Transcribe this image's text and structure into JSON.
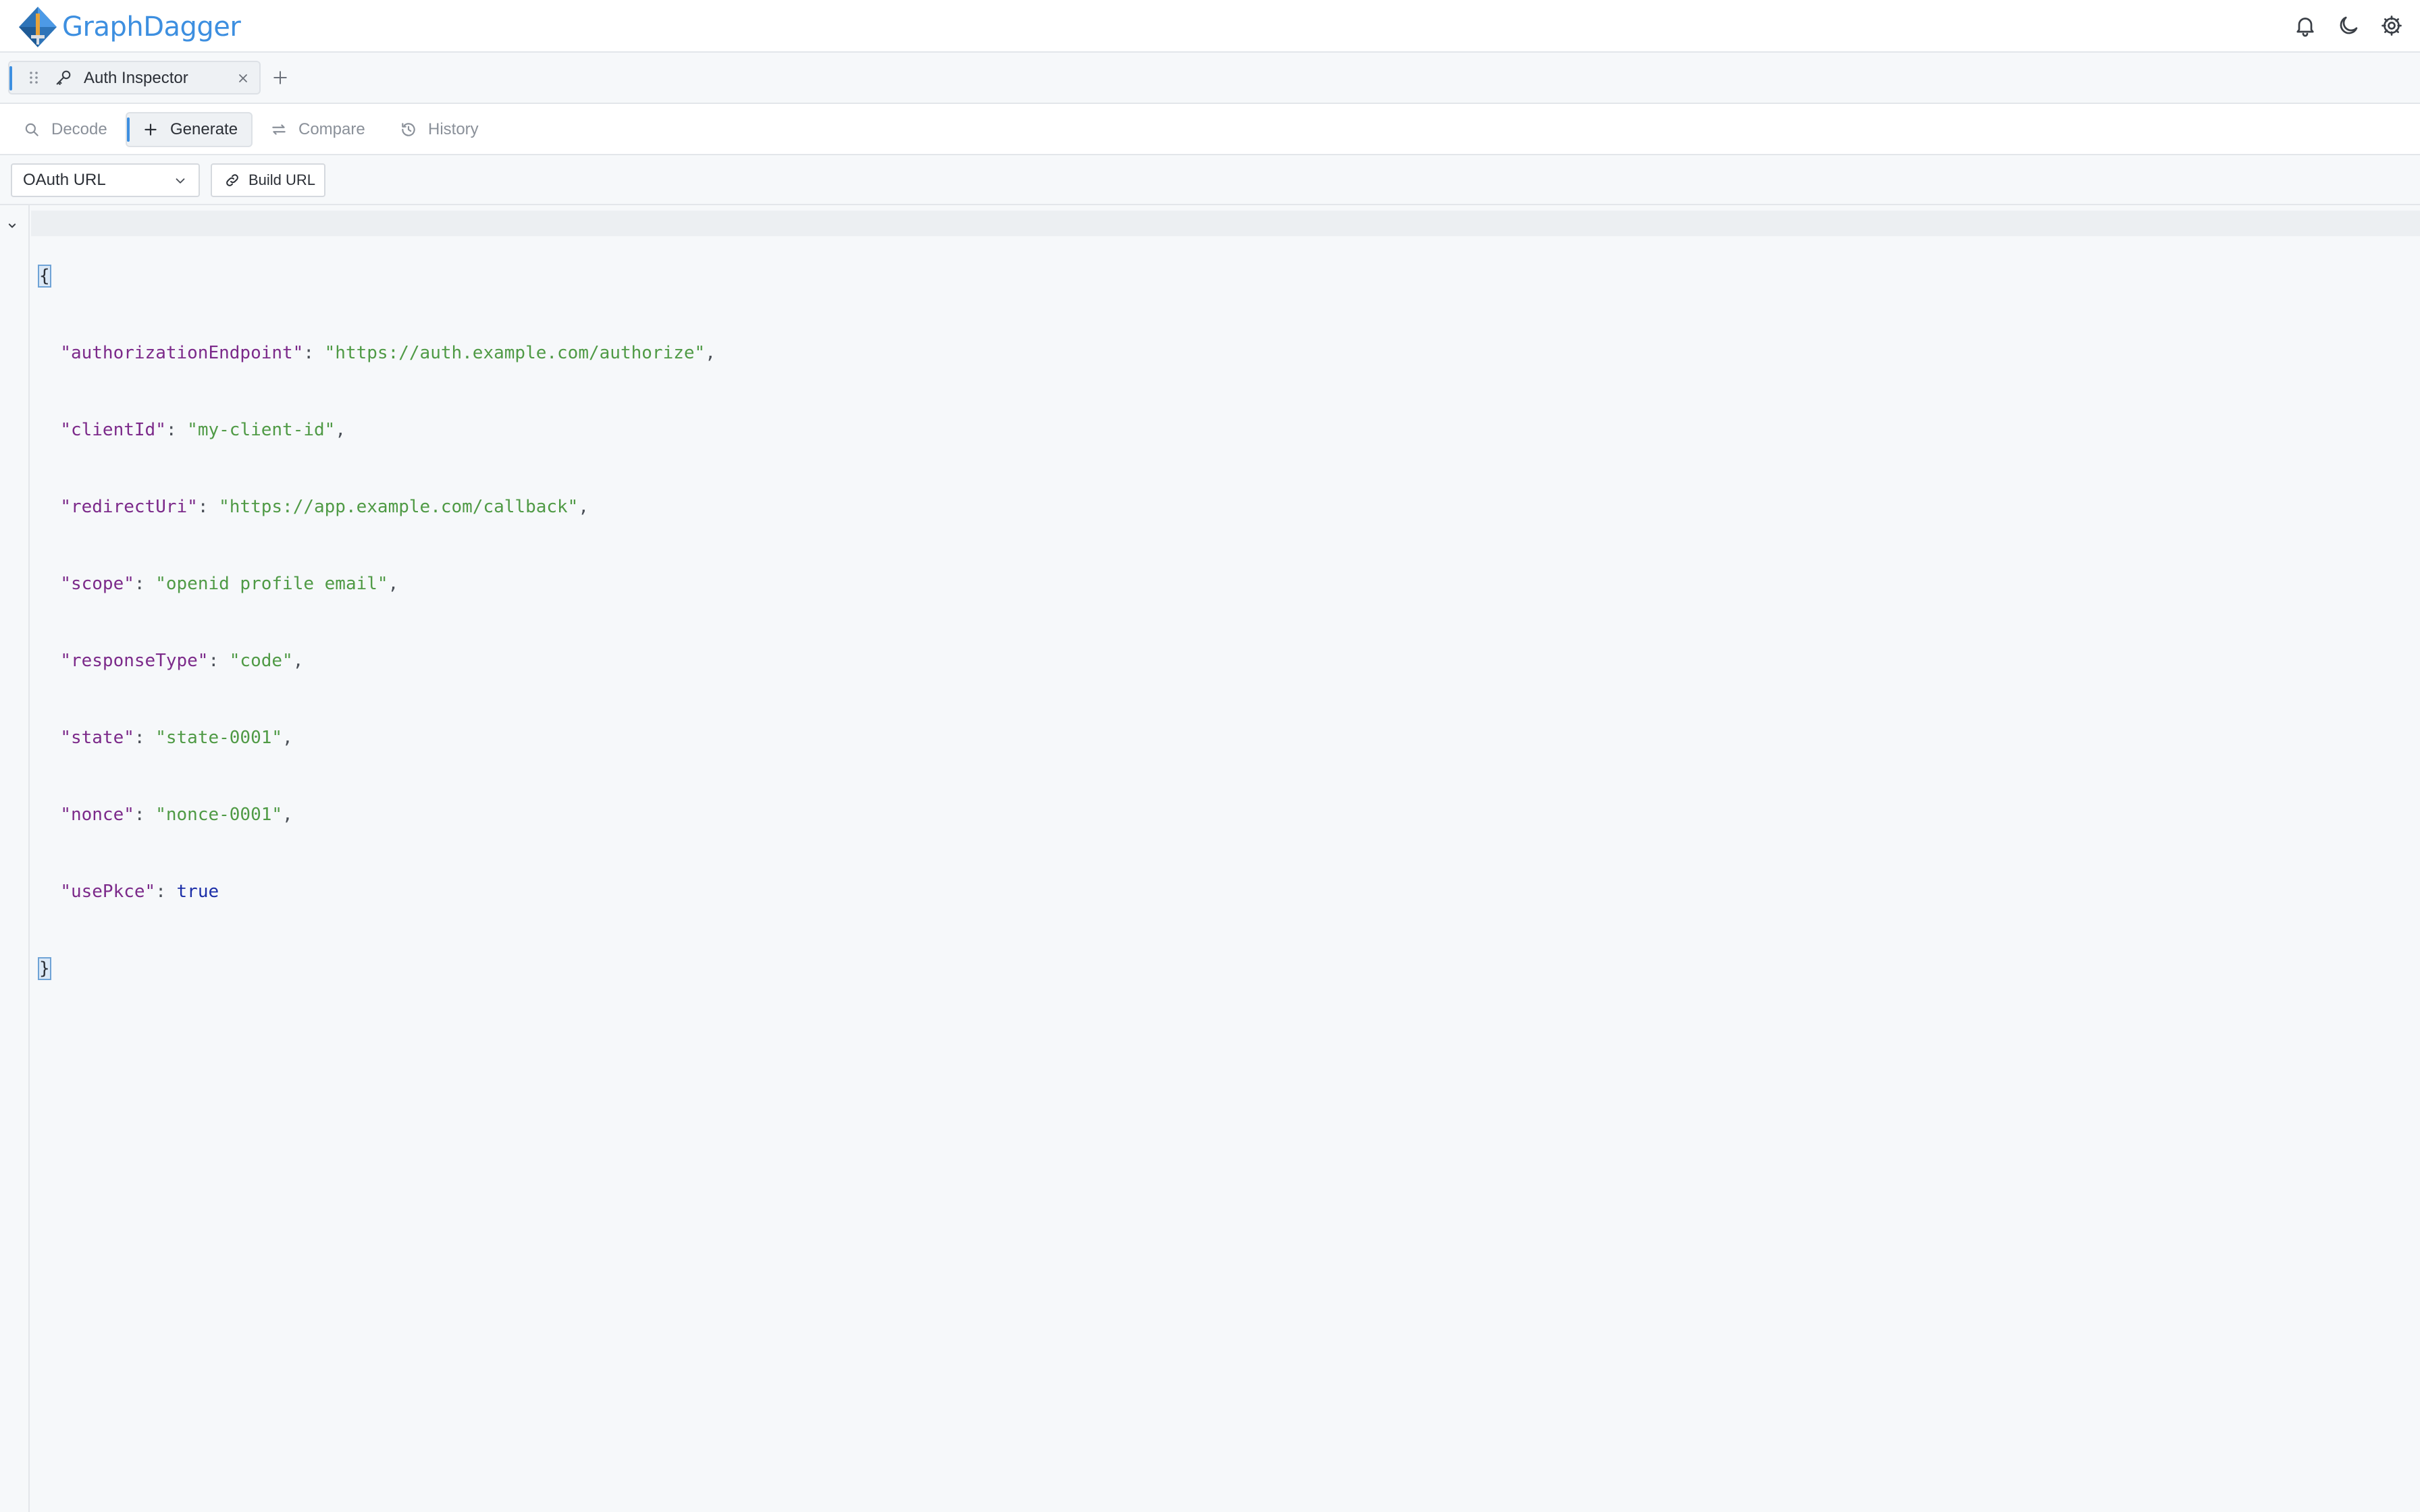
{
  "app": {
    "name": "GraphDagger"
  },
  "header": {
    "icons": [
      "bell-icon",
      "moon-icon",
      "gear-icon"
    ]
  },
  "tabs": [
    {
      "label": "Auth Inspector",
      "icon": "key-icon"
    }
  ],
  "modes": {
    "items": [
      {
        "label": "Decode",
        "icon": "search-icon"
      },
      {
        "label": "Generate",
        "icon": "plus-icon",
        "active": true
      },
      {
        "label": "Compare",
        "icon": "swap-icon"
      },
      {
        "label": "History",
        "icon": "history-icon"
      }
    ]
  },
  "toolbar": {
    "select_value": "OAuth URL",
    "build_label": "Build URL"
  },
  "editor": {
    "open_brace": "{",
    "close_brace": "}",
    "fields": [
      {
        "key": "\"authorizationEndpoint\"",
        "value": "\"https://auth.example.com/authorize\"",
        "type": "string",
        "comma": ","
      },
      {
        "key": "\"clientId\"",
        "value": "\"my-client-id\"",
        "type": "string",
        "comma": ","
      },
      {
        "key": "\"redirectUri\"",
        "value": "\"https://app.example.com/callback\"",
        "type": "string",
        "comma": ","
      },
      {
        "key": "\"scope\"",
        "value": "\"openid profile email\"",
        "type": "string",
        "comma": ","
      },
      {
        "key": "\"responseType\"",
        "value": "\"code\"",
        "type": "string",
        "comma": ","
      },
      {
        "key": "\"state\"",
        "value": "\"state-0001\"",
        "type": "string",
        "comma": ","
      },
      {
        "key": "\"nonce\"",
        "value": "\"nonce-0001\"",
        "type": "string",
        "comma": ","
      },
      {
        "key": "\"usePkce\"",
        "value": "true",
        "type": "boolean",
        "comma": ""
      }
    ]
  },
  "colors": {
    "accent": "#3d8fe0",
    "json_key": "#7c2a8a",
    "json_string": "#4f9a45",
    "json_boolean": "#1c2fa8"
  }
}
